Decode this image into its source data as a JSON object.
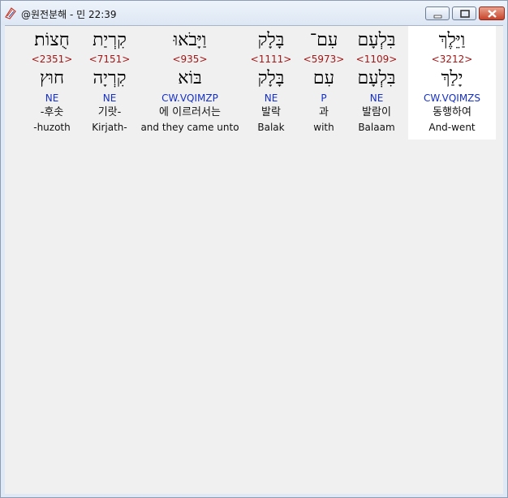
{
  "window": {
    "title": "@원전분해 - 민 22:39",
    "buttons": {
      "minimize": "minimize",
      "maximize": "maximize",
      "close": "close"
    }
  },
  "words": [
    {
      "hebrew": "וַיֵּלֶךְ",
      "strong": "<3212>",
      "lemma": "יָלַךְ",
      "parse": "CW.VQIMZS",
      "korean": "동행하여",
      "english": "And-went",
      "selected": true
    },
    {
      "hebrew": "בִּלְעָם",
      "strong": "<1109>",
      "lemma": "בִּלְעָם",
      "parse": "NE",
      "korean": "발람이",
      "english": "Balaam",
      "selected": false
    },
    {
      "hebrew": "עִם־",
      "strong": "<5973>",
      "lemma": "עִם",
      "parse": "P",
      "korean": "과",
      "english": "with",
      "selected": false
    },
    {
      "hebrew": "בָּלָק",
      "strong": "<1111>",
      "lemma": "בָּלָק",
      "parse": "NE",
      "korean": "발락",
      "english": "Balak",
      "selected": false
    },
    {
      "hebrew": "וַיָּבֹאוּ",
      "strong": "<935>",
      "lemma": "בּוֹא",
      "parse": "CW.VQIMZP",
      "korean": "에 이르러서는",
      "english": "and they came unto",
      "selected": false
    },
    {
      "hebrew": "קִרְיַת",
      "strong": "<7151>",
      "lemma": "קִרְיָה",
      "parse": "NE",
      "korean": "기랏-",
      "english": "Kirjath-",
      "selected": false
    },
    {
      "hebrew": "חֻצוֹת׃",
      "strong": "<2351>",
      "lemma": "חוּץ",
      "parse": "NE",
      "korean": "-후솟",
      "english": "-huzoth",
      "selected": false
    }
  ]
}
